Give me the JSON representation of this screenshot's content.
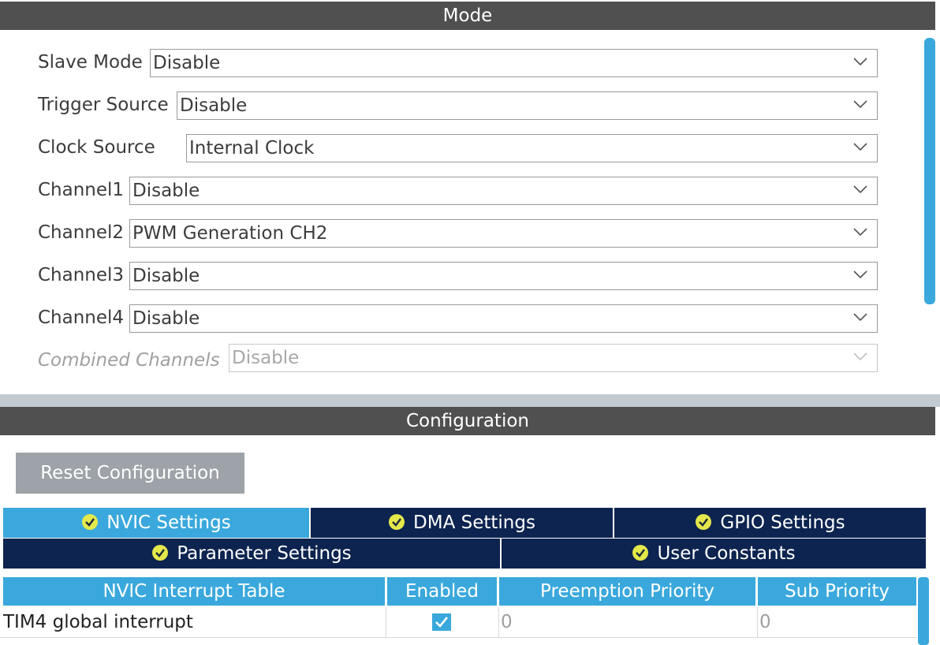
{
  "mode": {
    "header": "Mode",
    "rows": [
      {
        "label": "Slave Mode",
        "value": "Disable"
      },
      {
        "label": "Trigger Source",
        "value": "Disable"
      },
      {
        "label": "Clock Source",
        "value": "Internal Clock"
      },
      {
        "label": "Channel1",
        "value": "Disable"
      },
      {
        "label": "Channel2",
        "value": "PWM Generation CH2"
      },
      {
        "label": "Channel3",
        "value": "Disable"
      },
      {
        "label": "Channel4",
        "value": "Disable"
      },
      {
        "label": "Combined Channels",
        "value": "Disable",
        "disabled": true
      }
    ]
  },
  "config": {
    "header": "Configuration",
    "reset_button": "Reset Configuration",
    "tabs": [
      {
        "label": "NVIC Settings",
        "active": true
      },
      {
        "label": "DMA Settings"
      },
      {
        "label": "GPIO Settings"
      },
      {
        "label": "Parameter Settings"
      },
      {
        "label": "User Constants"
      }
    ],
    "table": {
      "headers": [
        "NVIC Interrupt Table",
        "Enabled",
        "Preemption Priority",
        "Sub Priority"
      ],
      "rows": [
        {
          "name": "TIM4 global interrupt",
          "enabled": true,
          "preemption": "0",
          "sub": "0"
        }
      ]
    }
  },
  "colors": {
    "header_bg": "#505050",
    "accent": "#3aa8dc",
    "tab_inactive": "#0d2450",
    "check_icon": "#e4e84a"
  }
}
